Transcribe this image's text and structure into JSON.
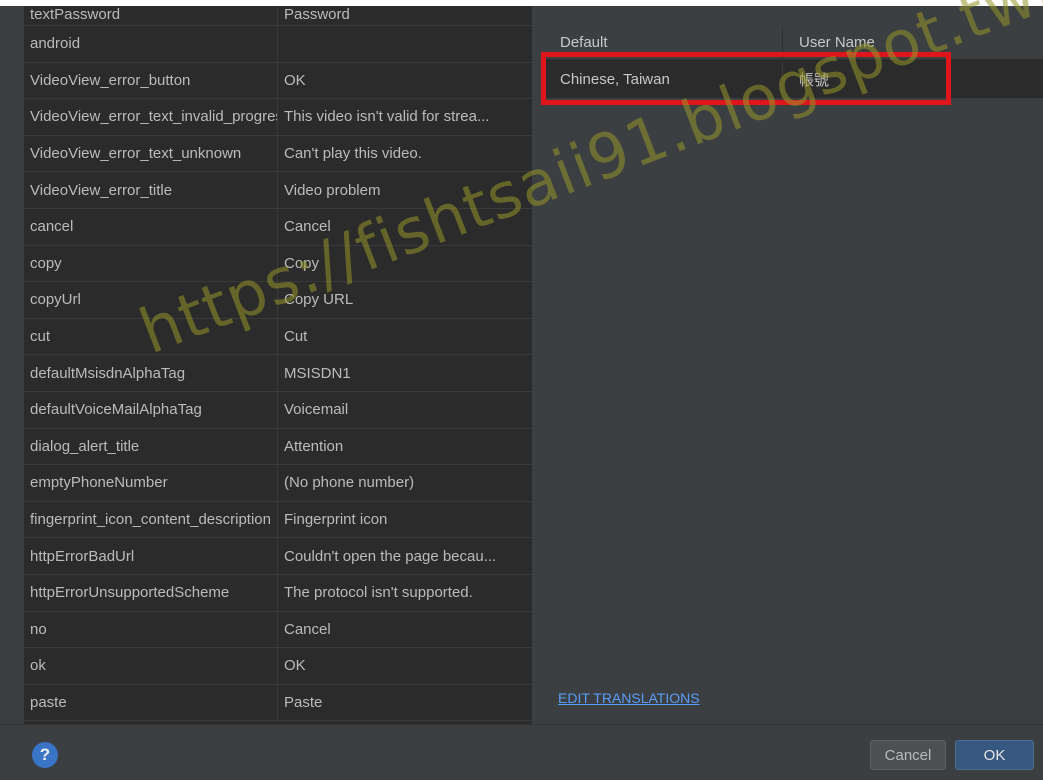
{
  "strings_table": {
    "rows": [
      {
        "key": "textPassword",
        "value": "Password"
      },
      {
        "key": "android",
        "value": ""
      },
      {
        "key": "VideoView_error_button",
        "value": "OK"
      },
      {
        "key": "VideoView_error_text_invalid_progress",
        "value": "This video isn't valid for strea..."
      },
      {
        "key": "VideoView_error_text_unknown",
        "value": "Can't play this video."
      },
      {
        "key": "VideoView_error_title",
        "value": "Video problem"
      },
      {
        "key": "cancel",
        "value": "Cancel"
      },
      {
        "key": "copy",
        "value": "Copy"
      },
      {
        "key": "copyUrl",
        "value": "Copy URL"
      },
      {
        "key": "cut",
        "value": "Cut"
      },
      {
        "key": "defaultMsisdnAlphaTag",
        "value": "MSISDN1"
      },
      {
        "key": "defaultVoiceMailAlphaTag",
        "value": "Voicemail"
      },
      {
        "key": "dialog_alert_title",
        "value": "Attention"
      },
      {
        "key": "emptyPhoneNumber",
        "value": "(No phone number)"
      },
      {
        "key": "fingerprint_icon_content_description",
        "value": "Fingerprint icon"
      },
      {
        "key": "httpErrorBadUrl",
        "value": "Couldn't open the page becau..."
      },
      {
        "key": "httpErrorUnsupportedScheme",
        "value": "The protocol isn't supported."
      },
      {
        "key": "no",
        "value": "Cancel"
      },
      {
        "key": "ok",
        "value": "OK"
      },
      {
        "key": "paste",
        "value": "Paste"
      }
    ]
  },
  "translations": {
    "header": {
      "col1": "Default",
      "col2": "User Name"
    },
    "rows": [
      {
        "locale": "Chinese, Taiwan",
        "value": "帳號"
      }
    ],
    "highlight_color": "#e0141b"
  },
  "edit_translations_label": "EDIT TRANSLATIONS",
  "buttons": {
    "help": "?",
    "cancel": "Cancel",
    "ok": "OK"
  },
  "watermark": "https://fishtsaii91.blogspot.tw/",
  "colors": {
    "link": "#589df6",
    "ok_button": "#365880",
    "help_icon": "#3a74c6"
  }
}
